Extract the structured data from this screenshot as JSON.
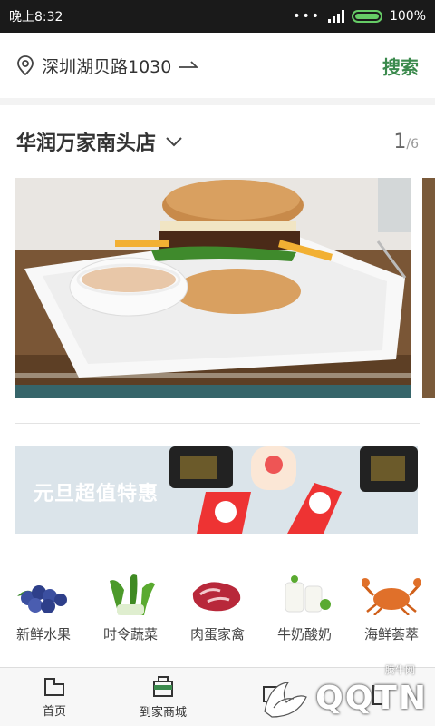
{
  "status_bar": {
    "time": "晚上8:32",
    "battery": "100%"
  },
  "header": {
    "address": "深圳湖贝路1030",
    "search_label": "搜索"
  },
  "store": {
    "name": "华润万家南头店",
    "page_current": "1",
    "page_total": "/6"
  },
  "promo": {
    "text": "元旦超值特惠"
  },
  "categories": [
    {
      "label": "新鲜水果",
      "icon": "blueberry-icon"
    },
    {
      "label": "时令蔬菜",
      "icon": "vegetable-icon"
    },
    {
      "label": "肉蛋家禽",
      "icon": "meat-icon"
    },
    {
      "label": "牛奶酸奶",
      "icon": "milk-icon"
    },
    {
      "label": "海鲜荟萃",
      "icon": "crab-icon"
    }
  ],
  "tabs": [
    {
      "label": "首页"
    },
    {
      "label": "到家商城"
    },
    {
      "label": ""
    },
    {
      "label": ""
    }
  ],
  "watermark": {
    "main": "QQTN",
    "sub": "腾牛网"
  },
  "colors": {
    "accent": "#3b8a4d",
    "status_bar": "#1a1a1a",
    "battery": "#66cc66"
  }
}
